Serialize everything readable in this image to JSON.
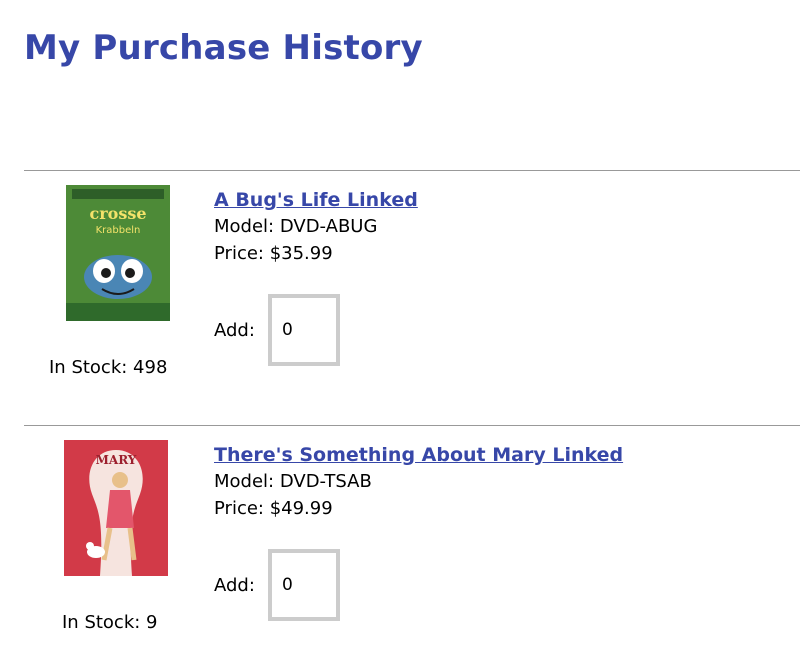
{
  "page": {
    "title": "My Purchase History"
  },
  "items": [
    {
      "name": "A Bug's Life Linked",
      "model": "Model: DVD-ABUG",
      "price": "Price: $35.99",
      "add_label": "Add:",
      "quantity": "0",
      "stock": "In Stock: 498",
      "cover_colors": {
        "primary": "#3e7a35",
        "accent": "#e0e070"
      }
    },
    {
      "name": "There's Something About Mary Linked",
      "model": "Model: DVD-TSAB",
      "price": "Price: $49.99",
      "add_label": "Add:",
      "quantity": "0",
      "stock": "In Stock: 9",
      "cover_colors": {
        "primary": "#d23a48",
        "accent": "#f6d8d0"
      }
    }
  ],
  "colors": {
    "accent": "#3747a8",
    "divider": "#999999",
    "input_border": "#cccccc"
  }
}
